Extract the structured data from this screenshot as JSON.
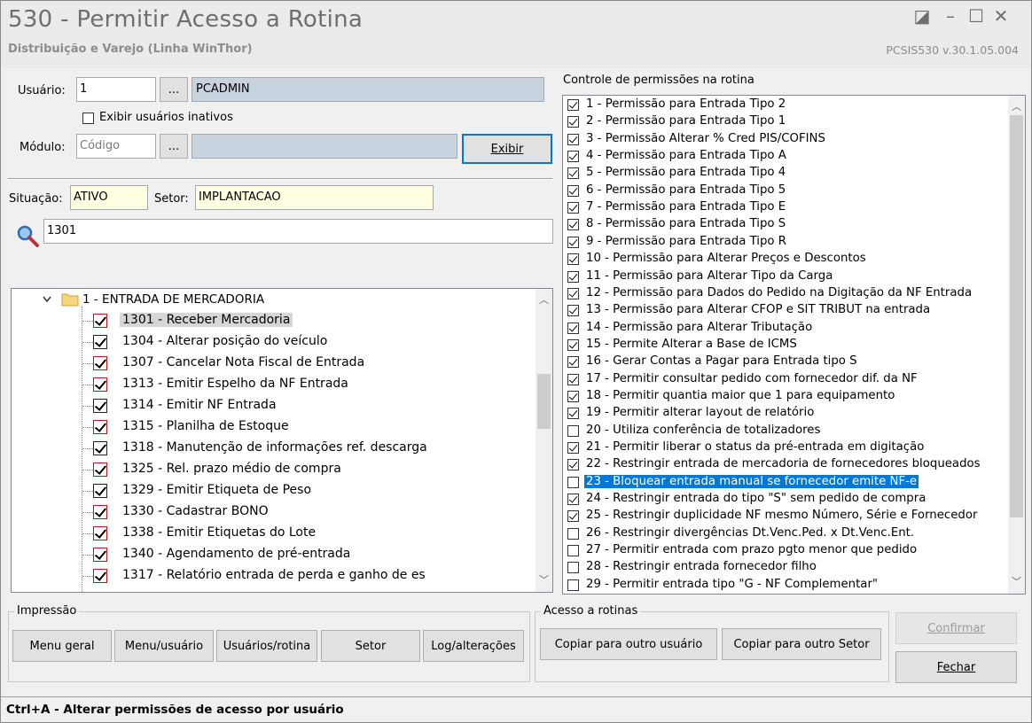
{
  "window": {
    "title": "530 - Permitir Acesso a Rotina",
    "subtitle": "Distribuição e Varejo (Linha WinThor)",
    "version": "PCSIS530  v.30.1.05.004",
    "restore_glyph": "◪",
    "min_glyph": "–",
    "max_glyph": "☐",
    "close_glyph": "✕"
  },
  "filters": {
    "usuario_label": "Usuário:",
    "usuario_code": "1",
    "browse_label": "...",
    "usuario_name": "PCADMIN",
    "exibir_inativos_label": "Exibir usuários inativos",
    "modulo_label": "Módulo:",
    "modulo_placeholder": "Código",
    "exibir_button": "Exibir",
    "situacao_label": "Situação:",
    "situacao_value": "ATIVO",
    "setor_label": "Setor:",
    "setor_value": "IMPLANTACAO",
    "search_value": "1301",
    "search_icon": "magnifier-icon"
  },
  "tree": {
    "folder_label": "1 - ENTRADA DE MERCADORIA",
    "items": [
      {
        "label": "1301 - Receber Mercadoria",
        "checked": true,
        "red": true,
        "selected": true
      },
      {
        "label": "1304 - Alterar posição do veículo",
        "checked": true,
        "red": false,
        "selected": false
      },
      {
        "label": "1307 - Cancelar Nota Fiscal de  Entrada",
        "checked": true,
        "red": true,
        "selected": false
      },
      {
        "label": "1313 - Emitir Espelho da NF Entrada",
        "checked": true,
        "red": true,
        "selected": false
      },
      {
        "label": "1314 - Emitir NF Entrada",
        "checked": true,
        "red": false,
        "selected": false
      },
      {
        "label": "1315 - Planilha de Estoque",
        "checked": true,
        "red": true,
        "selected": false
      },
      {
        "label": "1318 - Manutenção de informações ref. descarga",
        "checked": true,
        "red": false,
        "selected": false
      },
      {
        "label": "1325 - Rel. prazo médio de compra",
        "checked": true,
        "red": true,
        "selected": false
      },
      {
        "label": "1329 - Emitir Etiqueta de Peso",
        "checked": true,
        "red": false,
        "selected": false
      },
      {
        "label": "1330 - Cadastrar BONO",
        "checked": true,
        "red": true,
        "selected": false
      },
      {
        "label": "1338 - Emitir Etiquetas do Lote",
        "checked": true,
        "red": true,
        "selected": false
      },
      {
        "label": "1340 - Agendamento de pré-entrada",
        "checked": true,
        "red": true,
        "selected": false
      },
      {
        "label": "1317 - Relatório entrada de perda e ganho de es",
        "checked": true,
        "red": true,
        "selected": false
      }
    ]
  },
  "permissions": {
    "title": "Controle de permissões na rotina",
    "items": [
      {
        "label": "1 - Permissão para Entrada Tipo 2",
        "checked": true
      },
      {
        "label": "2 - Permissão para Entrada Tipo 1",
        "checked": true
      },
      {
        "label": "3 - Permissão Alterar % Cred PIS/COFINS",
        "checked": true
      },
      {
        "label": "4 - Permissão para Entrada Tipo A",
        "checked": true
      },
      {
        "label": "5 - Permissão para Entrada Tipo 4",
        "checked": true
      },
      {
        "label": "6 - Permissão para Entrada Tipo 5",
        "checked": true
      },
      {
        "label": "7 - Permissão para Entrada Tipo E",
        "checked": true
      },
      {
        "label": "8 - Permissão para Entrada Tipo S",
        "checked": true
      },
      {
        "label": "9 - Permissão para Entrada Tipo R",
        "checked": true
      },
      {
        "label": "10 - Permissão para Alterar Preços e Descontos",
        "checked": true
      },
      {
        "label": "11 - Permissão para Alterar Tipo da Carga",
        "checked": true
      },
      {
        "label": "12 - Permissão para Dados do Pedido na Digitação da NF Entrada",
        "checked": true
      },
      {
        "label": "13 - Permissão para Alterar CFOP e SIT TRIBUT na entrada",
        "checked": true
      },
      {
        "label": "14 - Permissão para Alterar Tributação",
        "checked": true
      },
      {
        "label": "15 - Permite Alterar a Base de ICMS",
        "checked": true
      },
      {
        "label": "16 - Gerar Contas a Pagar para Entrada tipo S",
        "checked": true
      },
      {
        "label": "17 - Permitir consultar pedido com fornecedor dif. da NF",
        "checked": true
      },
      {
        "label": "18 - Permitir quantia maior que 1 para equipamento",
        "checked": true
      },
      {
        "label": "19 - Permitir alterar layout de relatório",
        "checked": true
      },
      {
        "label": "20 - Utiliza conferência de totalizadores",
        "checked": false
      },
      {
        "label": "21 - Permitir liberar o status da pré-entrada em digitação",
        "checked": true
      },
      {
        "label": "22 - Restringir entrada de mercadoria de fornecedores bloqueados",
        "checked": true
      },
      {
        "label": "23 - Bloquear entrada manual se fornecedor emite NF-e",
        "checked": false,
        "selected": true
      },
      {
        "label": "24 - Restringir entrada do tipo \"S\" sem pedido de compra",
        "checked": true
      },
      {
        "label": "25 - Restringir duplicidade NF mesmo Número, Série e Fornecedor",
        "checked": true
      },
      {
        "label": "26 - Restringir divergências Dt.Venc.Ped. x Dt.Venc.Ent.",
        "checked": false
      },
      {
        "label": "27 - Permitir entrada com prazo pgto menor que pedido",
        "checked": false
      },
      {
        "label": "28 - Restringir entrada fornecedor filho",
        "checked": false
      },
      {
        "label": "29 - Permitir entrada tipo \"G - NF Complementar\"",
        "checked": false
      }
    ]
  },
  "impressao": {
    "title": "Impressão",
    "menu_geral": "Menu geral",
    "menu_usuario": "Menu/usuário",
    "usuarios_rotina": "Usuários/rotina",
    "setor": "Setor",
    "log_alteracoes": "Log/alterações"
  },
  "acesso": {
    "title": "Acesso a rotinas",
    "copiar_usuario": "Copiar para outro usuário",
    "copiar_setor": "Copiar para outro Setor"
  },
  "actions": {
    "confirmar": "Confirmar",
    "fechar": "Fechar"
  },
  "statusbar": {
    "text": "Ctrl+A - Alterar permissões de acesso por usuário"
  }
}
